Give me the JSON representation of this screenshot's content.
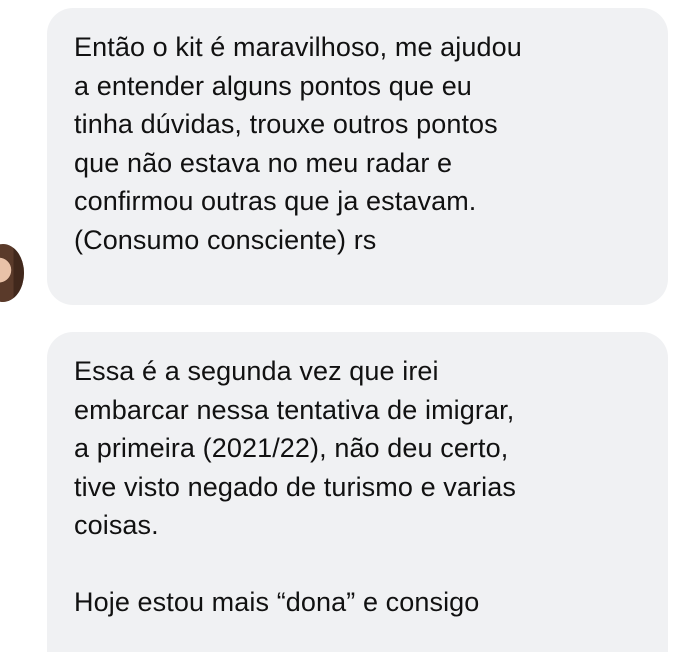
{
  "messages": [
    {
      "lines": [
        "Então o kit é maravilhoso, me ajudou",
        "a entender alguns pontos que eu",
        "tinha dúvidas, trouxe outros pontos",
        "que não estava no meu radar e",
        "confirmou outras que ja estavam.",
        "(Consumo consciente) rs"
      ]
    },
    {
      "lines": [
        "Essa é a segunda vez que irei",
        "embarcar nessa tentativa de imigrar,",
        "a primeira (2021/22), não deu certo,",
        "tive visto negado de turismo e varias",
        "coisas.",
        "",
        "Hoje estou mais “dona” e consigo"
      ]
    }
  ],
  "colors": {
    "bubble_background": "#f0f1f3",
    "text": "#111111"
  },
  "icons": {
    "avatar": "user-avatar-photo"
  }
}
